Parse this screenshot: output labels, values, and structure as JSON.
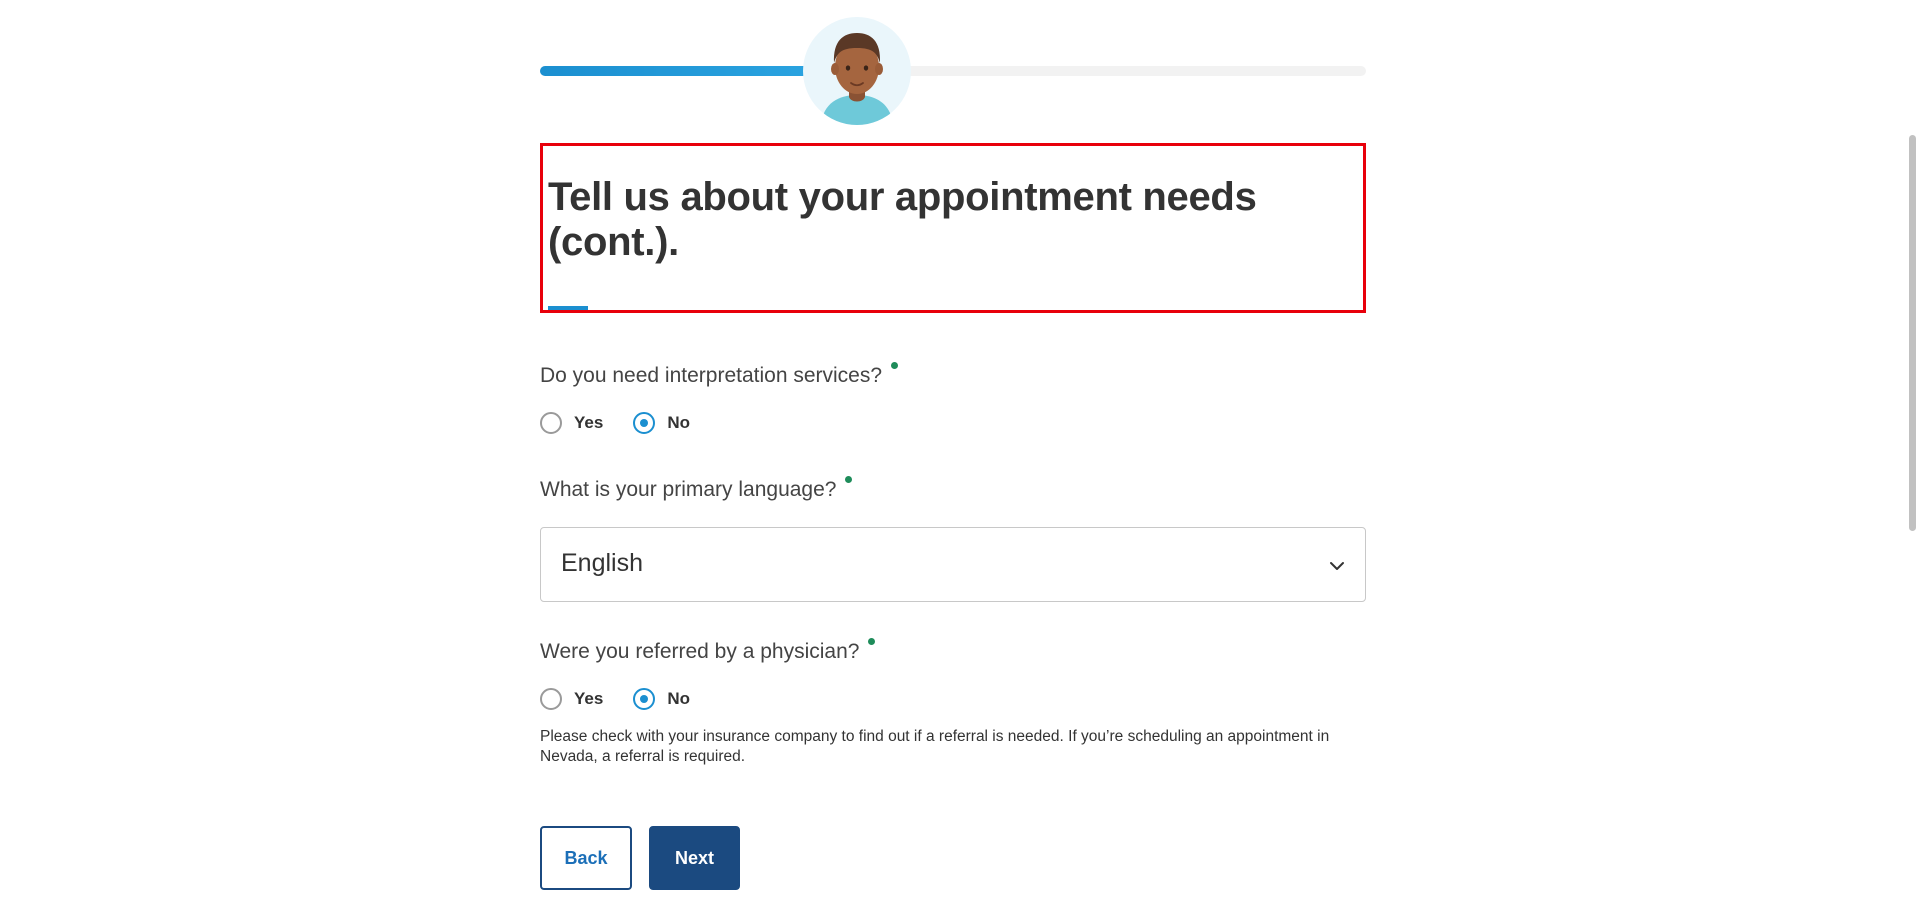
{
  "progress": {
    "fraction": 0.33
  },
  "heading": {
    "title": "Tell us about your appointment needs (cont.)."
  },
  "question1": {
    "label": "Do you need interpretation services?",
    "options": [
      {
        "label": "Yes",
        "selected": false
      },
      {
        "label": "No",
        "selected": true
      }
    ]
  },
  "question2": {
    "label": "What is your primary language?",
    "value": "English"
  },
  "question3": {
    "label": "Were you referred by a physician?",
    "options": [
      {
        "label": "Yes",
        "selected": false
      },
      {
        "label": "No",
        "selected": true
      }
    ],
    "note": "Please check with your insurance company to find out if a referral is needed. If you’re scheduling an appointment in Nevada, a referral is required."
  },
  "buttons": {
    "back": "Back",
    "next": "Next"
  },
  "colors": {
    "accent": "#1b8fd0",
    "primary_button": "#1b4a80",
    "required_dot": "#1e8c5a",
    "highlight_box": "#e8000b"
  }
}
